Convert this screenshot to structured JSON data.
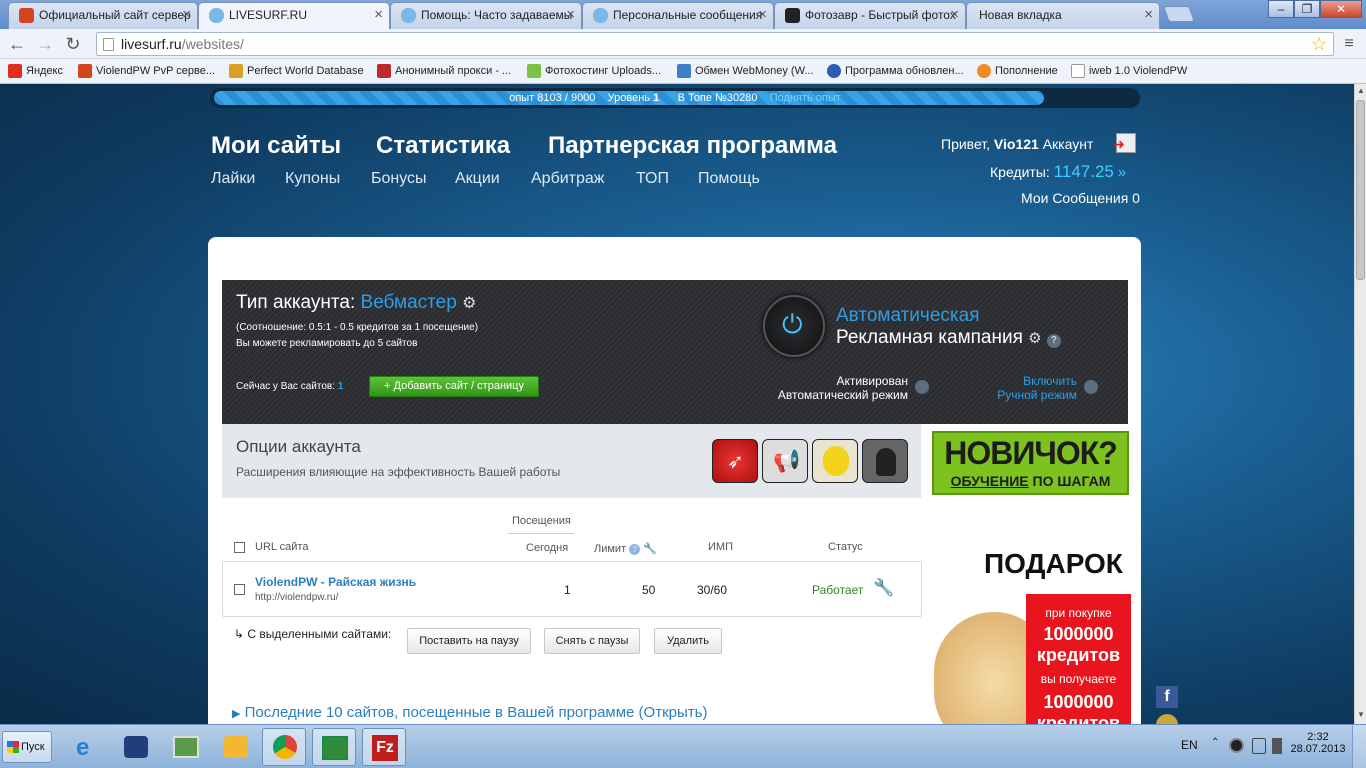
{
  "browser": {
    "tabs": [
      {
        "label": "Официальный сайт сервер",
        "color": "#d2451e"
      },
      {
        "label": "LIVESURF.RU",
        "color": "#7ab8e8"
      },
      {
        "label": "Помощь: Часто задаваемы",
        "color": "#7ab8e8"
      },
      {
        "label": "Персональные сообщения",
        "color": "#7ab8e8"
      },
      {
        "label": "Фотозавр - Быстрый фотох",
        "color": "#222222"
      },
      {
        "label": "Новая вкладка",
        "color": ""
      }
    ],
    "window_buttons": {
      "minimize": "–",
      "restore": "❐",
      "close": "✕"
    },
    "url": {
      "host": "livesurf.ru",
      "path": "/websites/"
    },
    "bookmarks": [
      {
        "label": "Яндекс",
        "color": "#e32b1e"
      },
      {
        "label": "ViolendPW PvP серве...",
        "color": "#d2451e"
      },
      {
        "label": "Perfect World Database",
        "color": "#d8a024"
      },
      {
        "label": "Анонимный прокси - ...",
        "color": "#c0282d"
      },
      {
        "label": "Фотохостинг Uploads...",
        "color": "#7bc242"
      },
      {
        "label": "Обмен WebMoney (W...",
        "color": "#3f7fc7"
      },
      {
        "label": "Программа обновлен...",
        "color": "#2a5cb0"
      },
      {
        "label": "Пополнение",
        "color": "#f08a24"
      },
      {
        "label": "iweb 1.0 ViolendPW",
        "color": "#dddddd"
      }
    ]
  },
  "site": {
    "xp_text": "опыт 8103 / 9000",
    "level_text": "Уровень",
    "level_value": "1",
    "top_text": "В Топе №30280",
    "level_up_link": "Поднять опыт",
    "xp_progress": 0.9,
    "main_nav": [
      "Мои сайты",
      "Статистика",
      "Партнерская программа"
    ],
    "sub_nav": [
      "Лайки",
      "Купоны",
      "Бонусы",
      "Акции",
      "Арбитраж",
      "ТОП",
      "Помощь"
    ],
    "greeting": "Привет,",
    "username": "Vio121",
    "account_link": "Аккаунт",
    "credits_label": "Кредиты:",
    "credits_value": "1147.25",
    "messages": "Мои Сообщения 0"
  },
  "account": {
    "type_label": "Тип аккаунта:",
    "type_value": "Вебмастер",
    "ratio": "(Соотношение: 0.5:1 - 0.5 кредитов за 1 посещение)",
    "limit": "Вы можете рекламировать до 5 сайтов",
    "sites_now_label": "Сейчас у Вас сайтов:",
    "sites_now_value": "1",
    "add_button": "Добавить сайт / страницу",
    "campaign_title_1": "Автоматическая",
    "campaign_title_2": "Рекламная кампания",
    "activated": "Активирован",
    "auto_mode": "Автоматический режим",
    "enable": "Включить",
    "manual_mode": "Ручной режим"
  },
  "options": {
    "title": "Опции аккаунта",
    "subtitle": "Расширения влияющие на эффективность Вашей работы",
    "icons": [
      "rocket-icon",
      "megaphone-icon",
      "chick-icon",
      "agent-icon"
    ]
  },
  "novice": {
    "title": "НОВИЧОК?",
    "sub_bold": "ОБУЧЕНИЕ",
    "sub_rest": " ПО ШАГАМ"
  },
  "table": {
    "group_header": "Посещения",
    "headers": {
      "url": "URL сайта",
      "today": "Сегодня",
      "limit": "Лимит",
      "imp": "ИМП",
      "status": "Статус"
    },
    "rows": [
      {
        "name": "ViolendPW - Райская жизнь",
        "url": "http://violendpw.ru/",
        "today": "1",
        "limit": "50",
        "imp": "30/60",
        "status": "Работает"
      }
    ],
    "selected_label": "С выделенными сайтами:",
    "actions": [
      "Поставить на паузу",
      "Снять с паузы",
      "Удалить"
    ],
    "recent_link": "Последние 10 сайтов, посещенные в Вашей программе (Открыть)"
  },
  "gift": {
    "title": "ПОДАРОК",
    "line1": "при покупке",
    "line2": "1000000",
    "line3": "кредитов",
    "line4": "вы получаете",
    "line5": "1000000",
    "line6": "кредитов"
  },
  "taskbar": {
    "start": "Пуск",
    "lang": "EN",
    "time": "2:32",
    "date": "28.07.2013"
  }
}
